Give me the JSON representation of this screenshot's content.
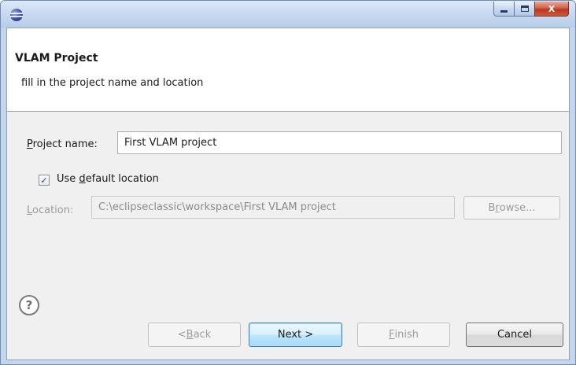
{
  "window": {
    "icon": "eclipse-icon",
    "controls": {
      "minimize": "minimize-icon",
      "maximize": "maximize-icon",
      "close": "X"
    }
  },
  "banner": {
    "title": "VLAM Project",
    "description": "fill in the project name and location"
  },
  "form": {
    "project_name": {
      "label_mnemonic": "P",
      "label_rest": "roject name:",
      "value": "First VLAM project"
    },
    "default_location": {
      "checked": true,
      "label_pre": "Use ",
      "label_mnemonic": "d",
      "label_post": "efault location",
      "check_glyph": "✓"
    },
    "location": {
      "label_mnemonic": "L",
      "label_rest": "ocation:",
      "value": "C:\\eclipseclassic\\workspace\\First VLAM project"
    },
    "browse": {
      "pre": "B",
      "mnemonic": "r",
      "post": "owse..."
    }
  },
  "footer": {
    "help_glyph": "?",
    "back": {
      "pre": "< ",
      "mnemonic": "B",
      "post": "ack"
    },
    "next": "Next >",
    "finish": {
      "mnemonic": "F",
      "post": "inish"
    },
    "cancel": "Cancel"
  },
  "colors": {
    "titlebar": "#c9daf0",
    "dialog_bg": "#f0f0f0",
    "close_button": "#c8432a",
    "default_button": "#3c7fb1"
  }
}
